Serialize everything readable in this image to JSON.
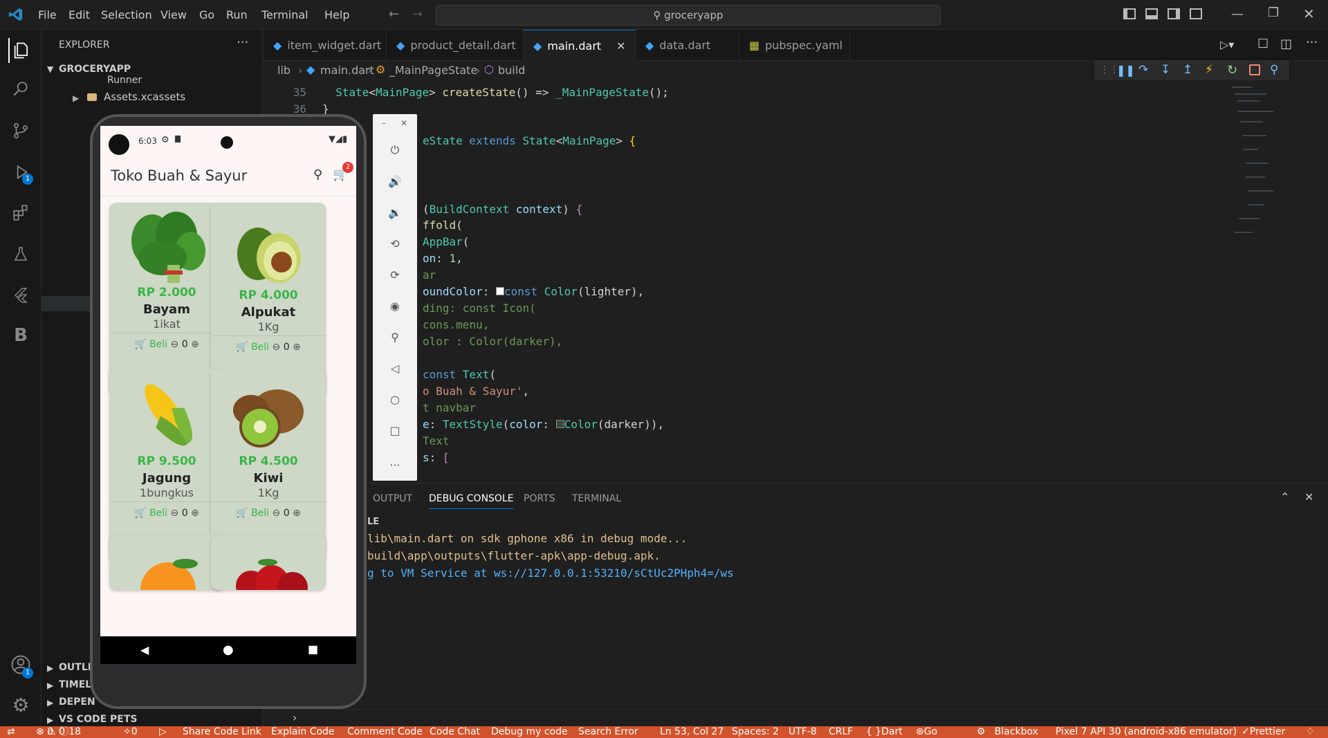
{
  "menu": {
    "items": [
      "File",
      "Edit",
      "Selection",
      "View",
      "Go",
      "Run",
      "Terminal",
      "Help"
    ],
    "search": "groceryapp"
  },
  "sidebar": {
    "title": "EXPLORER",
    "project": "GROCERYAPP",
    "runner": "Runner",
    "assets": "Assets.xcassets",
    "sections": [
      "OUTLI",
      "TIMEL",
      "DEPEN",
      "VS CODE PETS"
    ]
  },
  "tabs": [
    "item_widget.dart",
    "product_detail.dart",
    "main.dart",
    "data.dart",
    "pubspec.yaml"
  ],
  "breadcrumb": {
    "folder": "lib",
    "file": "main.dart",
    "cls": "_MainPageState",
    "method": "build"
  },
  "editor": {
    "lines": [
      {
        "n": "35",
        "html": "  <span class='ty'>State</span><span class='pl'>&lt;</span><span class='ty'>MainPage</span><span class='pl'>&gt; </span><span class='fn'>createState</span><span class='pl'>() =&gt; </span><span class='ty'>_MainPageState</span><span class='pl'>();</span>"
      },
      {
        "n": "36",
        "html": "<span class='pl'>}</span>"
      }
    ],
    "visible_fragments": [
      "eState extends State<MainPage> {",
      "(BuildContext context) {",
      "ffold(",
      "AppBar(",
      "on: 1,",
      "ar",
      "oundColor: const Color(lighter),",
      "ding: const Icon(",
      "cons.menu,",
      "olor : Color(darker),",
      "const Text(",
      "o Buah & Sayur',",
      "t navbar",
      "e: TextStyle(color: Color(darker)),",
      "Text",
      "s: ["
    ]
  },
  "panel": {
    "tabs": [
      "OUTPUT",
      "DEBUG CONSOLE",
      "PORTS",
      "TERMINAL"
    ],
    "active": "DEBUG CONSOLE",
    "header": "LE",
    "lines": [
      "lib\\main.dart on sdk gphone x86 in debug mode...",
      "build\\app\\outputs\\flutter-apk\\app-debug.apk.",
      "g to VM Service at ws://127.0.0.1:53210/sCtUc2PHph4=/ws"
    ]
  },
  "status": {
    "errors": "0",
    "warnings": "0",
    "info": "18",
    "ports": "0",
    "items": [
      "Share Code Link",
      "Explain Code",
      "Comment Code",
      "Code Chat",
      "Debug my code",
      "Search Error"
    ],
    "position": "Ln 53, Col 27",
    "spaces": "Spaces: 2",
    "encoding": "UTF-8",
    "eol": "CRLF",
    "language": "Dart",
    "golive": "Go Live",
    "blackbox": "Blackbox",
    "device": "Pixel 7 API 30 (android-x86 emulator)",
    "prettier": "Prettier"
  },
  "app": {
    "time": "6:03",
    "title": "Toko Buah & Sayur",
    "cart_count": "2",
    "products": [
      {
        "price": "RP 2.000",
        "name": "Bayam",
        "qty": "1ikat",
        "buy": "Beli",
        "count": "0"
      },
      {
        "price": "RP 4.000",
        "name": "Alpukat",
        "qty": "1Kg",
        "buy": "Beli",
        "count": "0"
      },
      {
        "price": "RP 9.500",
        "name": "Jagung",
        "qty": "1bungkus",
        "buy": "Beli",
        "count": "0"
      },
      {
        "price": "RP 4.500",
        "name": "Kiwi",
        "qty": "1Kg",
        "buy": "Beli",
        "count": "0"
      }
    ]
  },
  "badges": {
    "run": "1",
    "account": "1"
  }
}
